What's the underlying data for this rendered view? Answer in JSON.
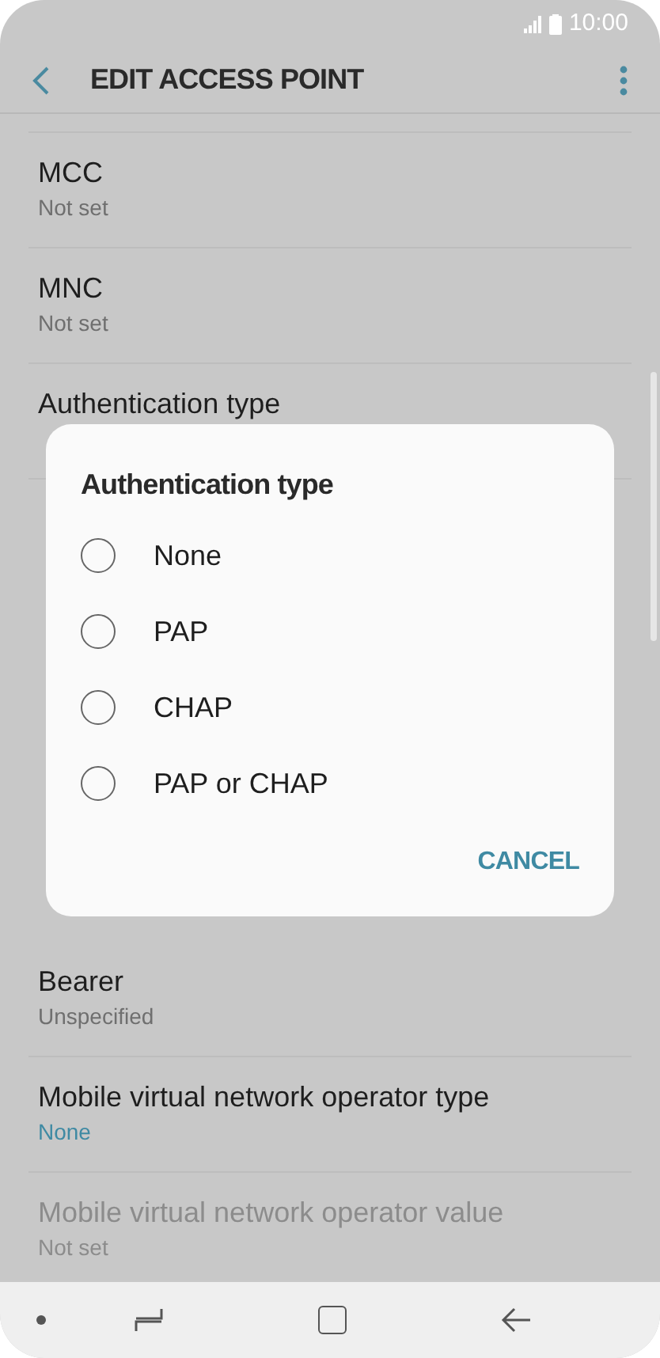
{
  "status_bar": {
    "time": "10:00"
  },
  "app_bar": {
    "title": "EDIT ACCESS POINT"
  },
  "settings": [
    {
      "title": "MCC",
      "value": "Not set",
      "value_accent": false,
      "disabled": false
    },
    {
      "title": "MNC",
      "value": "Not set",
      "value_accent": false,
      "disabled": false
    },
    {
      "title": "Authentication type",
      "disabled": false
    },
    {
      "title": "Bearer",
      "value": "Unspecified",
      "value_accent": false,
      "disabled": false
    },
    {
      "title": "Mobile virtual network operator type",
      "value": "None",
      "value_accent": true,
      "disabled": false
    },
    {
      "title": "Mobile virtual network operator value",
      "value": "Not set",
      "disabled": true
    }
  ],
  "dialog": {
    "title": "Authentication type",
    "options": [
      {
        "label": "None",
        "selected": false
      },
      {
        "label": "PAP",
        "selected": false
      },
      {
        "label": "CHAP",
        "selected": false
      },
      {
        "label": "PAP or CHAP",
        "selected": false
      }
    ],
    "buttons": [
      "CANCEL"
    ]
  }
}
